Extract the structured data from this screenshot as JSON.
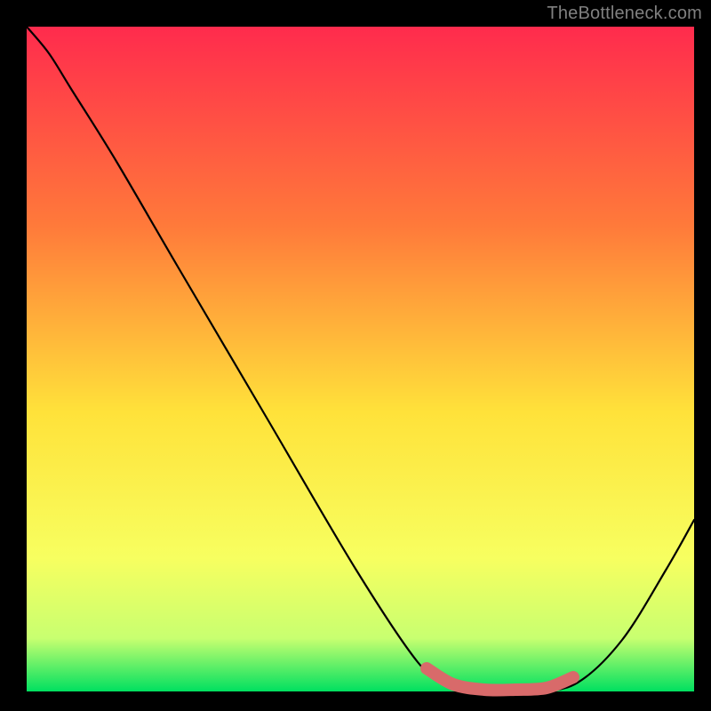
{
  "attribution": "TheBottleneck.com",
  "colors": {
    "page_bg": "#000000",
    "gradient_top": "#ff2b4d",
    "gradient_mid_upper": "#ff7a3a",
    "gradient_mid": "#ffe23a",
    "gradient_lower": "#f7ff60",
    "gradient_near_bottom": "#c8ff70",
    "gradient_bottom": "#00e060",
    "curve": "#000000",
    "highlight": "#d86a6a",
    "attribution_text": "#808080"
  },
  "chart_data": {
    "type": "line",
    "title": "",
    "xlabel": "",
    "ylabel": "",
    "xlim": [
      30,
      781
    ],
    "ylim": [
      30,
      778
    ],
    "series": [
      {
        "name": "bottleneck-curve",
        "x": [
          30,
          55,
          80,
          130,
          200,
          300,
          400,
          470,
          500,
          530,
          560,
          605,
          650,
          700,
          750,
          781
        ],
        "y": [
          30,
          60,
          100,
          180,
          300,
          470,
          640,
          745,
          765,
          775,
          778,
          778,
          768,
          720,
          640,
          585
        ]
      }
    ],
    "highlight_segment": {
      "name": "optimal-range",
      "x": [
        480,
        510,
        545,
        580,
        615,
        645
      ],
      "y": [
        752,
        770,
        776,
        776,
        774,
        762
      ]
    }
  }
}
